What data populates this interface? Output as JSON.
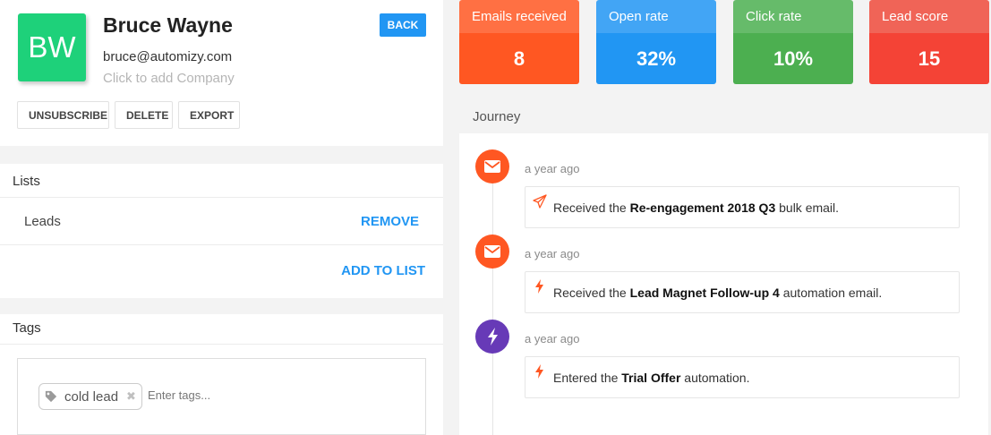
{
  "contact": {
    "initials": "BW",
    "name": "Bruce Wayne",
    "email": "bruce@automizy.com",
    "company_placeholder": "Click to add Company",
    "avatar_color": "#1ed17a"
  },
  "buttons": {
    "back": "BACK",
    "unsubscribe": "UNSUBSCRIBE",
    "delete": "DELETE",
    "export": "EXPORT"
  },
  "lists": {
    "title": "Lists",
    "items": [
      {
        "name": "Leads",
        "action": "REMOVE"
      }
    ],
    "add_label": "ADD TO LIST"
  },
  "tags": {
    "title": "Tags",
    "items": [
      {
        "label": "cold lead",
        "icon": "tag-icon",
        "remove_icon": "close-icon"
      }
    ],
    "input_placeholder": "Enter tags..."
  },
  "stats": [
    {
      "label": "Emails received",
      "value": "8",
      "color": "#ff5722"
    },
    {
      "label": "Open rate",
      "value": "32%",
      "color": "#2196f3"
    },
    {
      "label": "Click rate",
      "value": "10%",
      "color": "#4caf50"
    },
    {
      "label": "Lead score",
      "value": "15",
      "color": "#f44336"
    }
  ],
  "journey": {
    "title": "Journey",
    "events": [
      {
        "time": "a year ago",
        "badge_icon": "envelope-icon",
        "detail_icon": "paper-plane-icon",
        "prefix": "Received the ",
        "highlight": "Re-engagement 2018 Q3",
        "suffix": " bulk email."
      },
      {
        "time": "a year ago",
        "badge_icon": "envelope-icon",
        "detail_icon": "lightning-icon",
        "prefix": "Received the ",
        "highlight": "Lead Magnet Follow-up 4",
        "suffix": " automation email."
      },
      {
        "time": "a year ago",
        "badge_icon": "lightning-icon",
        "detail_icon": "lightning-icon",
        "prefix": "Entered the ",
        "highlight": "Trial Offer",
        "suffix": " automation."
      }
    ]
  }
}
